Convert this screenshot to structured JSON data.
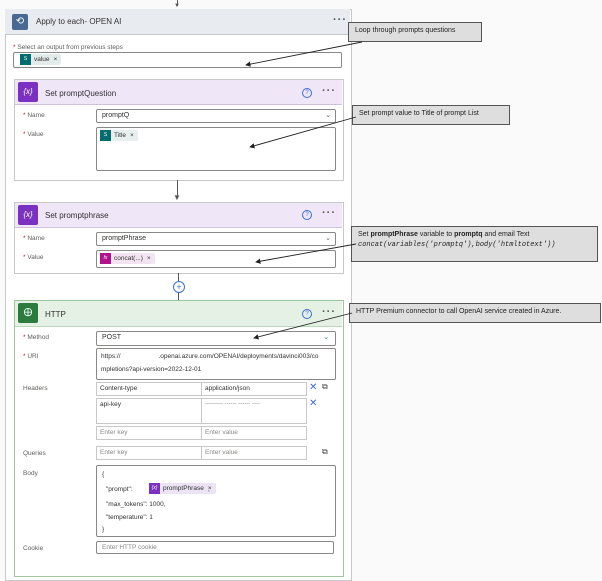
{
  "loop": {
    "title": "Apply to each- OPEN AI",
    "select_label": "Select an output from previous steps",
    "token": "value",
    "more": "···"
  },
  "set_prompt_question": {
    "title": "Set promptQuestion",
    "name_label": "Name",
    "name_value": "promptQ",
    "value_label": "Value",
    "value_token": "Title",
    "help": "?",
    "more": "···"
  },
  "set_prompt_phrase": {
    "title": "Set promptphrase",
    "name_label": "Name",
    "name_value": "promptPhrase",
    "value_label": "Value",
    "value_token": "concat(...)",
    "help": "?",
    "more": "···"
  },
  "http": {
    "title": "HTTP",
    "help": "?",
    "more": "···",
    "method_label": "Method",
    "method_value": "POST",
    "uri_label": "URI",
    "uri_line1": "https://                     .openai.azure.com/OPENAI/deployments/davinci003/co",
    "uri_line2": "mpletions?api-version=2022-12-01",
    "headers_label": "Headers",
    "headers": [
      {
        "key": "Content-type",
        "value": "application/json"
      },
      {
        "key": "api-key",
        "value": "--------- ------ ------ ----"
      },
      {
        "key": "Enter key",
        "value": "Enter value"
      }
    ],
    "queries_label": "Queries",
    "queries_key_ph": "Enter key",
    "queries_value_ph": "Enter value",
    "body_label": "Body",
    "body_lines": [
      "{",
      "\"prompt\":",
      "\"max_tokens\": 1000,",
      "\"temperature\": 1",
      "}"
    ],
    "body_token": "promptPhrase",
    "body_comma": ",",
    "cookie_label": "Cookie",
    "cookie_ph": "Enter HTTP cookie"
  },
  "callouts": {
    "loop": "Loop through prompts questions",
    "prompt_value": "Set prompt value to Title of prompt List",
    "phrase_pre": "Set ",
    "phrase_b1": "promptPhrase",
    "phrase_mid": " variable to ",
    "phrase_b2": "promptq",
    "phrase_post": " and email Text",
    "phrase_code": "concat(variables('promptq'),body('htmltotext'))",
    "http": "HTTP Premium connector to call OpenAI service created in Azure."
  },
  "colors": {
    "variable": "#7a31c2",
    "http": "#2b7a3e",
    "loop": "#486991"
  }
}
